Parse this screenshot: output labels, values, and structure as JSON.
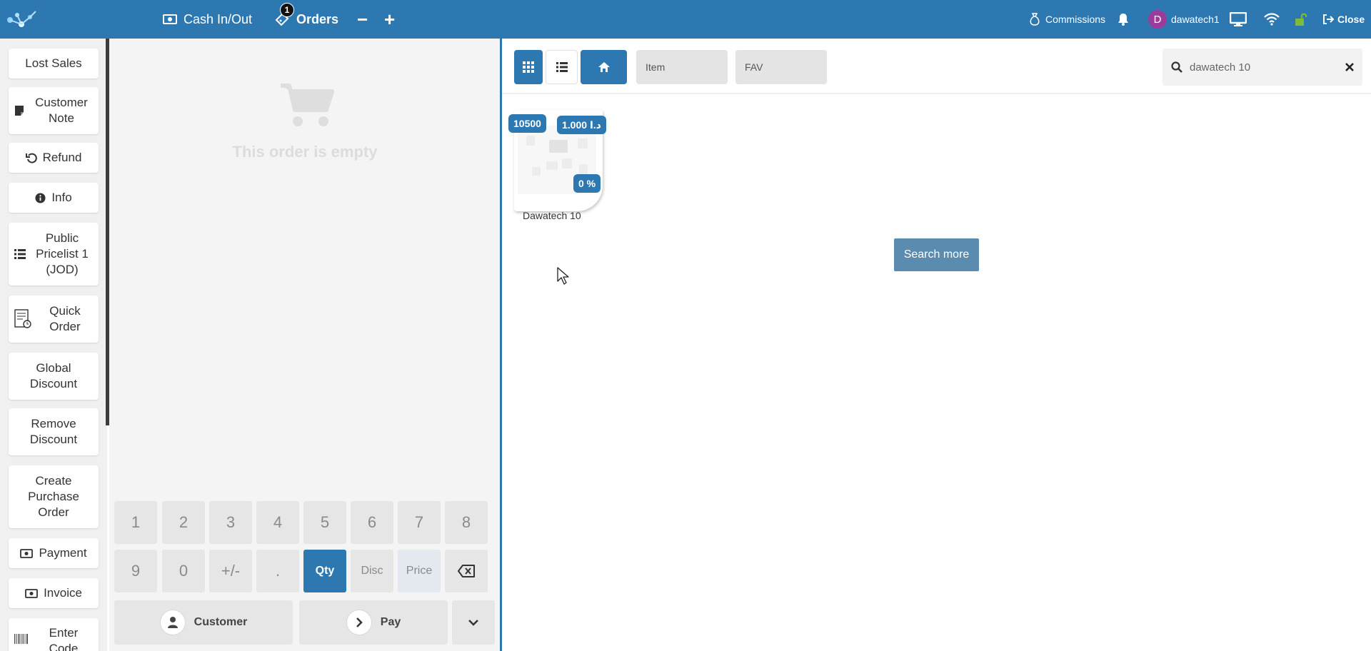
{
  "topbar": {
    "cash_label": "Cash In/Out",
    "orders_label": "Orders",
    "orders_count": "1",
    "minus_label": "−",
    "plus_label": "+",
    "commissions_label": "Commissions",
    "user_initial": "D",
    "user_name": "dawatech1",
    "close_label": "Close"
  },
  "sidebar": {
    "buttons": [
      {
        "label": "Lost Sales"
      },
      {
        "label": "Customer Note"
      },
      {
        "label": "Refund"
      },
      {
        "label": "Info"
      },
      {
        "label": "Public Pricelist 1 (JOD)"
      },
      {
        "label": "Quick Order"
      },
      {
        "label": "Global Discount"
      },
      {
        "label": "Remove Discount"
      },
      {
        "label": "Create Purchase Order"
      },
      {
        "label": "Payment"
      },
      {
        "label": "Invoice"
      },
      {
        "label": "Enter Code"
      }
    ]
  },
  "order": {
    "empty_text": "This order is empty"
  },
  "numpad": {
    "keys": [
      "1",
      "2",
      "3",
      "4",
      "5",
      "6",
      "7",
      "8",
      "9",
      "0",
      "+/-",
      ".",
      "Qty",
      "Disc",
      "Price"
    ],
    "customer_label": "Customer",
    "pay_label": "Pay"
  },
  "products_header": {
    "categories": [
      "Item",
      "FAV"
    ],
    "search_value": "dawatech 10"
  },
  "products": [
    {
      "name": "Dawatech 10",
      "qty": "10500",
      "price": "1.000 د.ا",
      "discount": "0 %"
    }
  ],
  "search_more_label": "Search more",
  "colors": {
    "accent": "#2e78b1",
    "avatar": "#9b3b9c",
    "lock": "#7dbb3a"
  }
}
